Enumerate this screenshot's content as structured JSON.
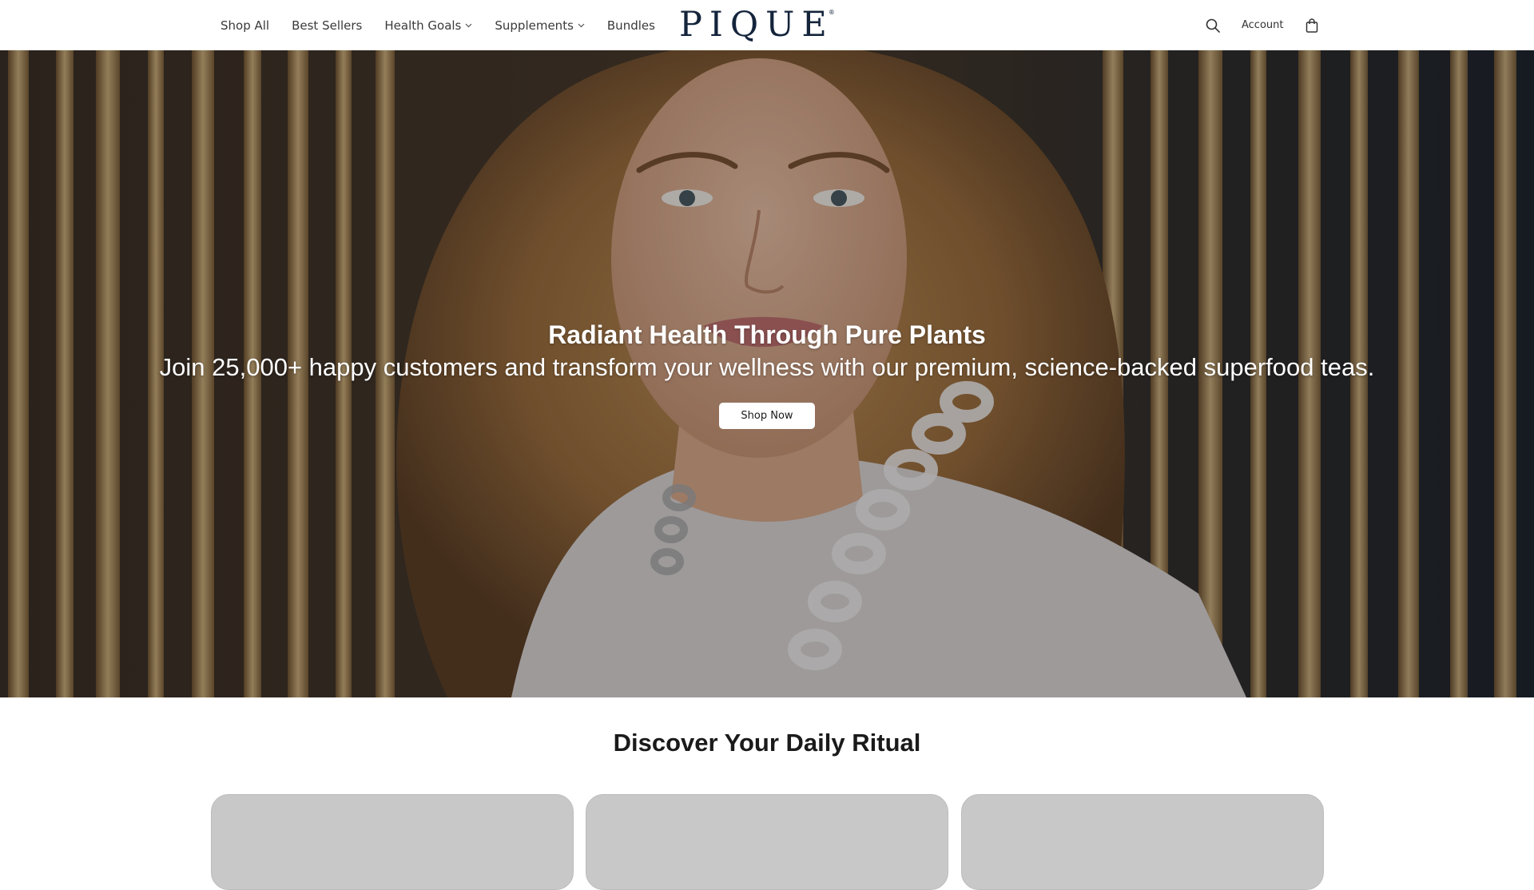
{
  "header": {
    "nav": [
      {
        "label": "Shop All",
        "dropdown": false
      },
      {
        "label": "Best Sellers",
        "dropdown": false
      },
      {
        "label": "Health Goals",
        "dropdown": true
      },
      {
        "label": "Supplements",
        "dropdown": true
      },
      {
        "label": "Bundles",
        "dropdown": false
      }
    ],
    "logo": {
      "text": "PIQUE",
      "mark": "®"
    },
    "account_label": "Account",
    "icons": {
      "search": "search-icon",
      "cart": "shopping-bag-icon"
    }
  },
  "hero": {
    "title": "Radiant Health Through Pure Plants",
    "subtitle": "Join 25,000+ happy customers and transform your wellness with our premium, science-backed superfood teas.",
    "cta_label": "Shop Now"
  },
  "section": {
    "title": "Discover Your Daily Ritual",
    "cards": 3
  },
  "colors": {
    "logo": "#14243b",
    "card_placeholder": "#c8c8c8",
    "nav_text": "#3a3a3a"
  }
}
